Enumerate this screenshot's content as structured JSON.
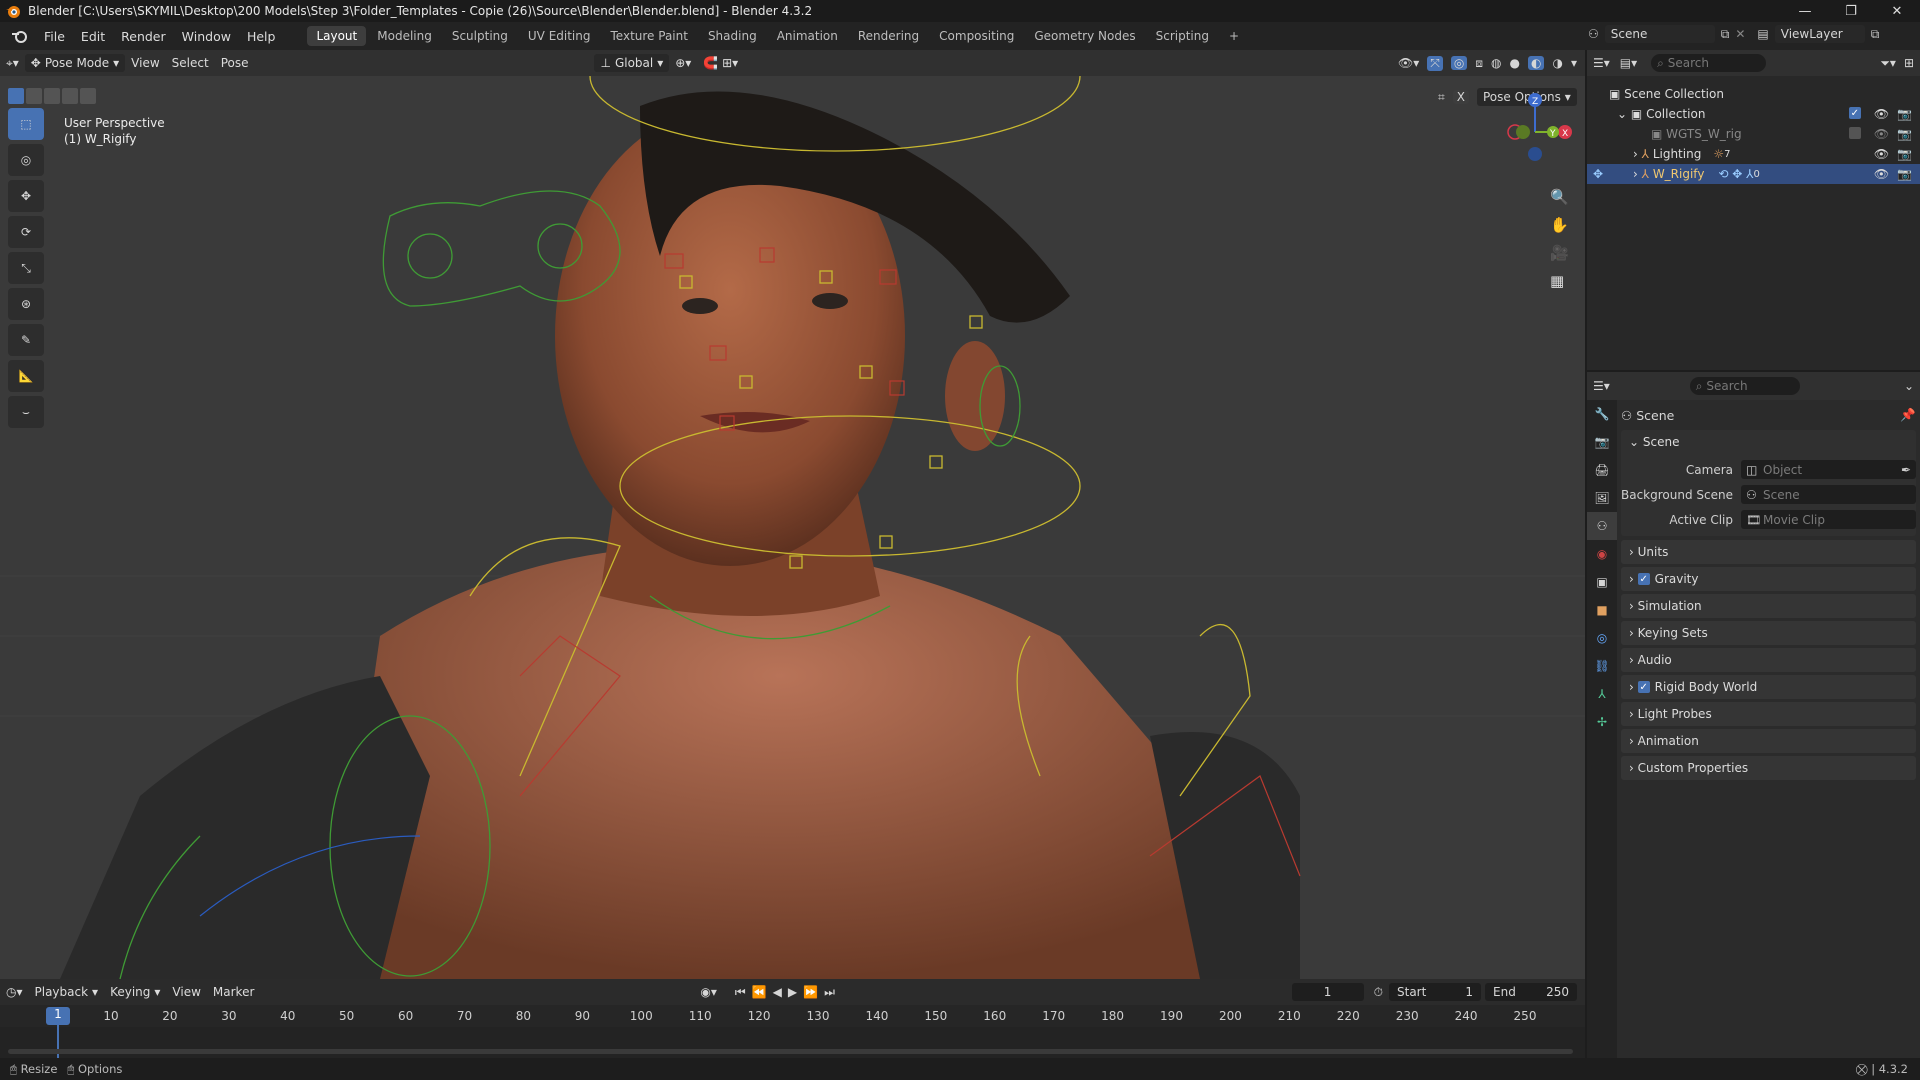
{
  "window": {
    "title": "Blender [C:\\Users\\SKYMIL\\Desktop\\200 Models\\Step 3\\Folder_Templates - Copie (26)\\Source\\Blender\\Blender.blend] - Blender 4.3.2"
  },
  "menu": [
    "File",
    "Edit",
    "Render",
    "Window",
    "Help"
  ],
  "workspaces": [
    "Layout",
    "Modeling",
    "Sculpting",
    "UV Editing",
    "Texture Paint",
    "Shading",
    "Animation",
    "Rendering",
    "Compositing",
    "Geometry Nodes",
    "Scripting"
  ],
  "active_workspace": "Layout",
  "scene_selector": "Scene",
  "viewlayer_selector": "ViewLayer",
  "viewport_header": {
    "mode": "Pose Mode",
    "menus": [
      "View",
      "Select",
      "Pose"
    ],
    "transform_orientation": "Global",
    "pose_options": "Pose Options"
  },
  "viewport": {
    "perspective": "User Perspective",
    "object_label": "(1) W_Rigify",
    "gizmo_axes": [
      "Z",
      "Y",
      "X"
    ]
  },
  "outliner": {
    "search_placeholder": "Search",
    "root": "Scene Collection",
    "collection": "Collection",
    "items": [
      {
        "name": "WGTS_W_rig"
      },
      {
        "name": "Lighting",
        "badge": "7"
      },
      {
        "name": "W_Rigify",
        "badge": "0"
      }
    ]
  },
  "properties": {
    "search_placeholder": "Search",
    "context": "Scene",
    "section": "Scene",
    "fields": [
      {
        "label": "Camera",
        "value": "Object"
      },
      {
        "label": "Background Scene",
        "value": "Scene"
      },
      {
        "label": "Active Clip",
        "value": "Movie Clip"
      }
    ],
    "panels": [
      {
        "label": "Units",
        "checkbox": null
      },
      {
        "label": "Gravity",
        "checkbox": true
      },
      {
        "label": "Simulation",
        "checkbox": null
      },
      {
        "label": "Keying Sets",
        "checkbox": null
      },
      {
        "label": "Audio",
        "checkbox": null
      },
      {
        "label": "Rigid Body World",
        "checkbox": true
      },
      {
        "label": "Light Probes",
        "checkbox": null
      },
      {
        "label": "Animation",
        "checkbox": null
      },
      {
        "label": "Custom Properties",
        "checkbox": null
      }
    ]
  },
  "timeline": {
    "menus": [
      "Playback",
      "Keying",
      "View",
      "Marker"
    ],
    "current_frame": "1",
    "start_label": "Start",
    "start": "1",
    "end_label": "End",
    "end": "250",
    "ticks": [
      "10",
      "20",
      "30",
      "40",
      "50",
      "60",
      "70",
      "80",
      "90",
      "100",
      "110",
      "120",
      "130",
      "140",
      "150",
      "160",
      "170",
      "180",
      "190",
      "200",
      "210",
      "220",
      "230",
      "240",
      "250"
    ],
    "playhead": "1"
  },
  "statusbar": {
    "left": [
      "Resize",
      "Options"
    ],
    "version": "4.3.2"
  },
  "colors": {
    "accent": "#4772b3",
    "selected_row": "#334d80",
    "viewport_bg": "#3a3a3a",
    "rig_yellow": "#d4c23a",
    "rig_red": "#c0302a",
    "rig_green": "#4aa33a"
  }
}
